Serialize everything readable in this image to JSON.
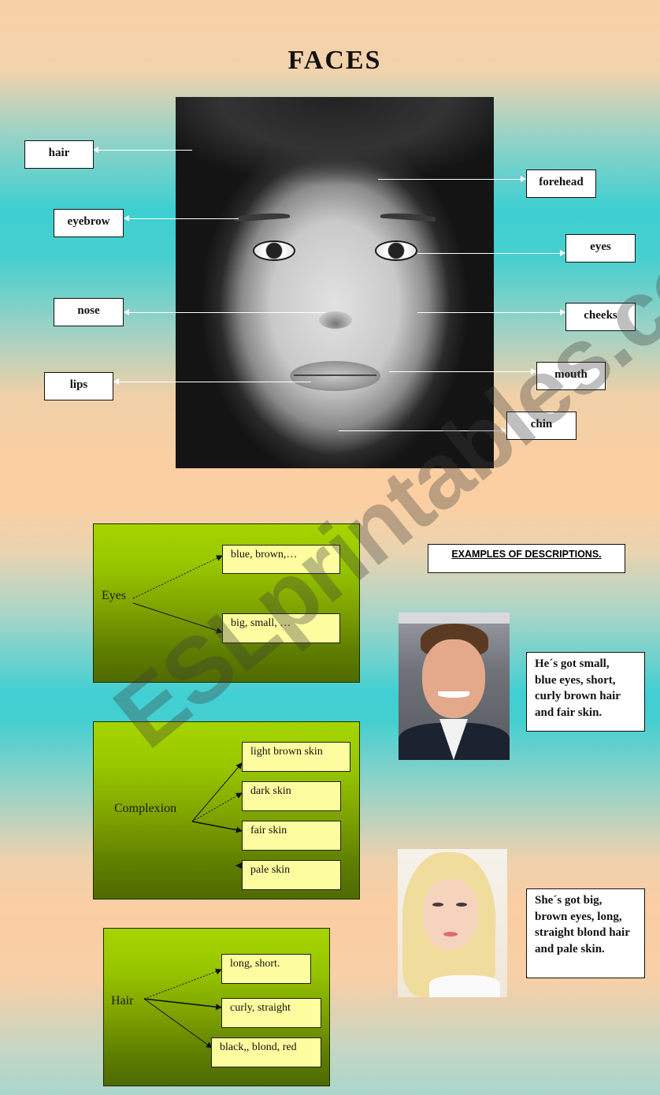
{
  "title": "FACES",
  "face_labels": {
    "hair": "hair",
    "eyebrow": "eyebrow",
    "nose": "nose",
    "lips": "lips",
    "forehead": "forehead",
    "eyes": "eyes",
    "cheeks": "cheeks",
    "mouth": "mouth",
    "chin": "chin"
  },
  "diagrams": {
    "eyes": {
      "label": "Eyes",
      "options": [
        "blue, brown,…",
        "big, small, …"
      ]
    },
    "complexion": {
      "label": "Complexion",
      "options": [
        "light brown skin",
        "dark skin",
        "fair skin",
        "pale skin"
      ]
    },
    "hair": {
      "label": "Hair",
      "options": [
        "long, short.",
        "curly, straight",
        "black,, blond, red"
      ]
    }
  },
  "examples": {
    "heading": "EXAMPLES OF DESCRIPTIONS.",
    "man": {
      "lines": [
        "He´s got small,",
        "blue eyes, short,",
        "curly brown hair",
        "and fair skin."
      ]
    },
    "woman": {
      "lines": [
        "She´s got big,",
        "brown eyes, long,",
        "straight blond hair",
        "and pale skin."
      ]
    }
  },
  "watermark": "ESLprintables.com",
  "colors": {
    "diagram_green_top": "#a6d400",
    "diagram_green_bottom": "#4f6a00",
    "option_yellow": "#fdfd9f",
    "teal": "#3ecfd1",
    "peach": "#fbcfa2"
  }
}
